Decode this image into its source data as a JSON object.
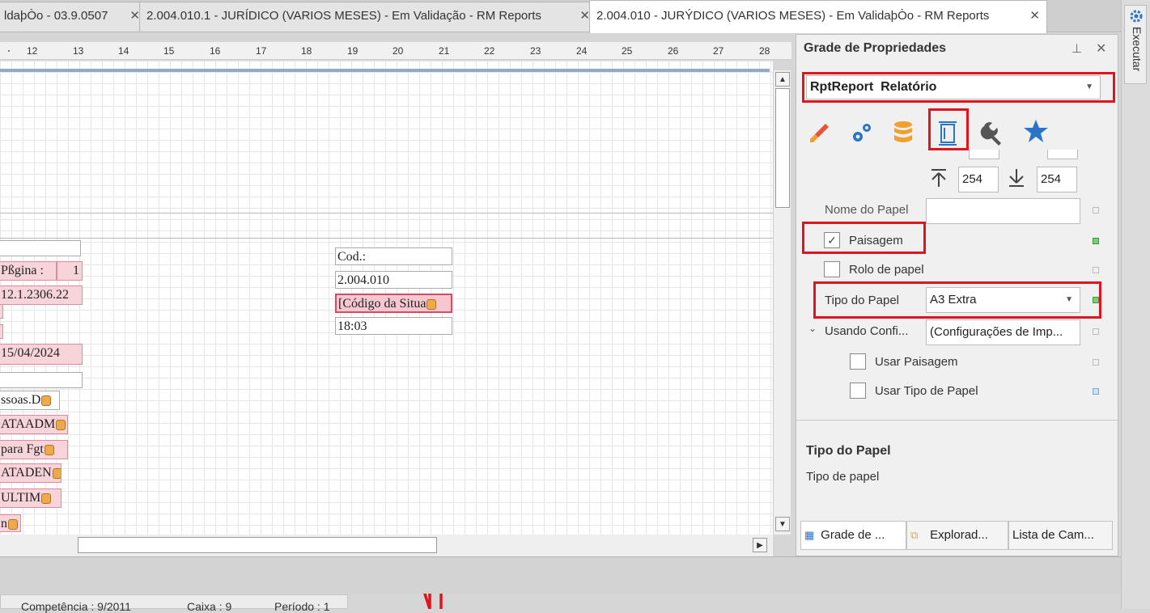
{
  "tabs": [
    {
      "label": "ldaþÒo - 03.9.0507"
    },
    {
      "label": "2.004.010.1 - JURÍDICO (VARIOS MESES) - Em Validação - RM Reports"
    },
    {
      "label": "2.004.010 - JURÝDICO (VARIOS MESES) - Em ValidaþÒo - RM Reports"
    }
  ],
  "ruler": [
    "12",
    "13",
    "14",
    "15",
    "16",
    "17",
    "18",
    "19",
    "20",
    "21",
    "22",
    "23",
    "24",
    "25",
    "26",
    "27",
    "28"
  ],
  "fields_left": [
    {
      "text": ""
    },
    {
      "text": "Pßgina :"
    },
    {
      "text": "1"
    },
    {
      "text": "12.1.2306.22"
    },
    {
      "text": ""
    },
    {
      "text": ""
    },
    {
      "text": "15/04/2024"
    },
    {
      "text": ""
    },
    {
      "text": "ssoas.D"
    },
    {
      "text": "ATAADM"
    },
    {
      "text": " para Fgt"
    },
    {
      "text": "ATADEN"
    },
    {
      "text": "ULTIM"
    },
    {
      "text": "n"
    }
  ],
  "fields_mid": [
    {
      "text": "Cod.:"
    },
    {
      "text": "2.004.010"
    },
    {
      "text": "[Código da Situa"
    },
    {
      "text": "18:03"
    }
  ],
  "panel": {
    "title": "Grade de Propriedades",
    "pin": "⊥",
    "close": "✕",
    "selector_obj": "RptReport",
    "selector_name": "Relatório",
    "margin_top_value": "254",
    "margin_bottom_value": "254",
    "nome_papel_label": "Nome do Papel",
    "nome_papel_value": "",
    "paisagem_label": "Paisagem",
    "paisagem_checked": "✓",
    "rolo_label": "Rolo de papel",
    "tipo_label": "Tipo do Papel",
    "tipo_value": "A3 Extra",
    "usando_label": "Usando Confi...",
    "usando_value": "(Configurações de Imp...",
    "usar_paisagem_label": "Usar Paisagem",
    "usar_tipo_label": "Usar Tipo de Papel",
    "desc_title": "Tipo do Papel",
    "desc_text": "Tipo de papel",
    "bottom_tabs": [
      "Grade de ...",
      "Explorad...",
      "Lista de Cam..."
    ],
    "colors": {
      "accent_red": "#e0141e",
      "green": "#3a9a3a",
      "blue": "#2a74c9",
      "orange": "#f0a030"
    }
  },
  "status": {
    "competencia": "Competência : 9/2011",
    "caixa": "Caixa : 9",
    "periodo": "Período : 1"
  },
  "side": {
    "executar": "Executar"
  }
}
